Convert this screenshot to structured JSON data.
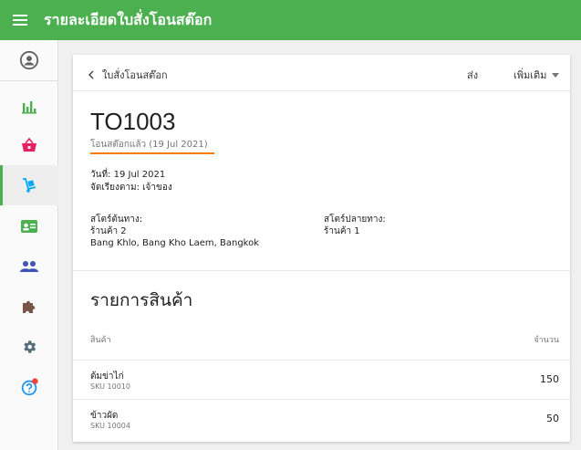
{
  "appbar": {
    "title": "รายละเอียดใบสั่งโอนสต๊อก",
    "color": "#4caf50"
  },
  "sidebar": {
    "items": [
      {
        "icon": "account-circle-icon"
      },
      {
        "icon": "bar-chart-icon"
      },
      {
        "icon": "basket-icon"
      },
      {
        "icon": "dolly-icon",
        "active": true
      },
      {
        "icon": "id-card-icon"
      },
      {
        "icon": "people-icon"
      },
      {
        "icon": "puzzle-icon"
      },
      {
        "icon": "gear-icon"
      },
      {
        "icon": "help-icon"
      }
    ]
  },
  "header": {
    "back_label": "ใบสั่งโอนสต๊อก",
    "send_label": "ส่ง",
    "more_label": "เพิ่มเติม"
  },
  "order": {
    "id": "TO1003",
    "status": "โอนสต๊อกแล้ว (19 Jul 2021)",
    "date": "วันที่: 19 Jul 2021",
    "sort": "จัดเรียงตาม: เจ้าของ",
    "source": {
      "label": "สโตร์ต้นทาง:",
      "name": "ร้านค้า 2",
      "address": "Bang Khlo, Bang Kho Laem, Bangkok"
    },
    "destination": {
      "label": "สโตร์ปลายทาง:",
      "name": "ร้านค้า 1"
    }
  },
  "items_section": {
    "title": "รายการสินค้า",
    "col_product": "สินค้า",
    "col_qty": "จำนวน",
    "rows": [
      {
        "name": "ต้มข่าไก่",
        "sku": "SKU 10010",
        "qty": "150"
      },
      {
        "name": "ข้าวผัด",
        "sku": "SKU 10004",
        "qty": "50"
      }
    ]
  }
}
